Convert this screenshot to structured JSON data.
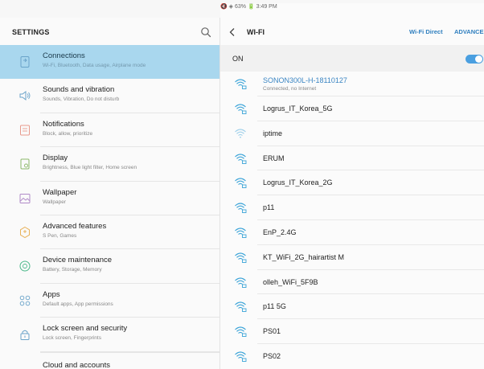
{
  "status_bar": {
    "text": "🔇 ◈ 63% 🔋 3:49 PM"
  },
  "left_panel": {
    "title": "SETTINGS",
    "menu": [
      {
        "title": "Connections",
        "subtitle": "Wi-Fi, Bluetooth, Data usage, Airplane mode",
        "icon": "connections-icon",
        "selected": true
      },
      {
        "title": "Sounds and vibration",
        "subtitle": "Sounds, Vibration, Do not disturb",
        "icon": "sound-icon"
      },
      {
        "title": "Notifications",
        "subtitle": "Block, allow, prioritize",
        "icon": "notifications-icon"
      },
      {
        "title": "Display",
        "subtitle": "Brightness, Blue light filter, Home screen",
        "icon": "display-icon"
      },
      {
        "title": "Wallpaper",
        "subtitle": "Wallpaper",
        "icon": "wallpaper-icon"
      },
      {
        "title": "Advanced features",
        "subtitle": "S Pen, Games",
        "icon": "advanced-features-icon"
      },
      {
        "title": "Device maintenance",
        "subtitle": "Battery, Storage, Memory",
        "icon": "device-maintenance-icon"
      },
      {
        "title": "Apps",
        "subtitle": "Default apps, App permissions",
        "icon": "apps-icon"
      },
      {
        "title": "Lock screen and security",
        "subtitle": "Lock screen, Fingerprints",
        "icon": "lock-icon"
      },
      {
        "title": "Cloud and accounts",
        "subtitle": "",
        "icon": "cloud-icon"
      }
    ]
  },
  "right_panel": {
    "title": "WI-FI",
    "wifi_direct": "Wi-Fi Direct",
    "advanced": "ADVANCED",
    "on_label": "ON",
    "toggle_on": true,
    "networks": [
      {
        "name": "SONON300L-H-18110127",
        "status": "Connected, no Internet"
      },
      {
        "name": "Logrus_IT_Korea_5G"
      },
      {
        "name": "iptime"
      },
      {
        "name": "ERUM"
      },
      {
        "name": "Logrus_IT_Korea_2G"
      },
      {
        "name": "p11"
      },
      {
        "name": "EnP_2.4G"
      },
      {
        "name": "KT_WiFi_2G_hairartist M"
      },
      {
        "name": "olleh_WiFi_5F9B"
      },
      {
        "name": "p11 5G"
      },
      {
        "name": "PS01"
      },
      {
        "name": "PS02"
      }
    ]
  },
  "colors": {
    "accent": "#2f7fbf",
    "selected_bg": "#a9d7ee",
    "wifi_icon": "#3aa3d8",
    "menu_icons": [
      "#6aa3c9",
      "#6aa3c9",
      "#e89a8c",
      "#8cb86a",
      "#b08ac8",
      "#e8b25a",
      "#4bb88a",
      "#6aa3c9",
      "#6aa3c9",
      "#e8955a"
    ]
  }
}
